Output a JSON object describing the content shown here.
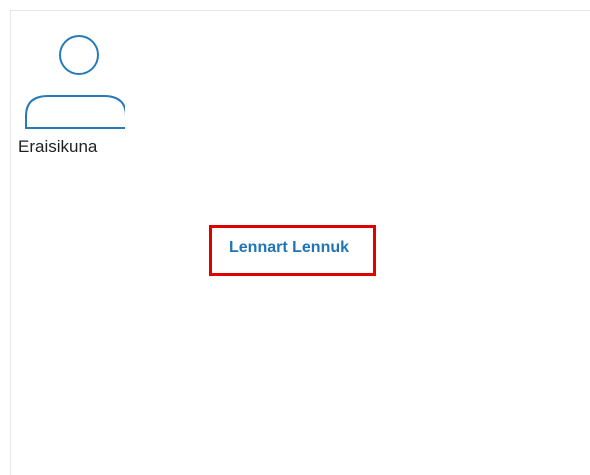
{
  "profile": {
    "avatar_icon": "person-outline-icon",
    "person_type": "Eraisikuna"
  },
  "representative": {
    "name": "Lennart Lennuk"
  },
  "colors": {
    "icon_stroke": "#2a7ab8",
    "link": "#1f75b6",
    "highlight_border": "#e00000"
  }
}
